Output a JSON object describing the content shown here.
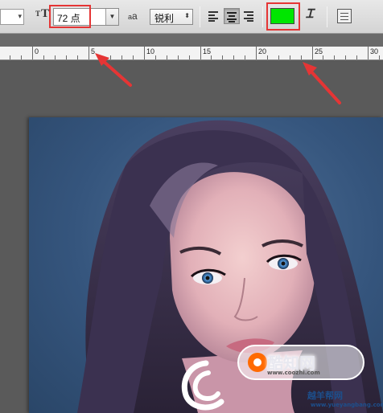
{
  "options_bar": {
    "font_size_value": "72 点",
    "antialias_value": "锐利",
    "text_color": "#00e600",
    "highlight_color": "#e53535"
  },
  "ruler": {
    "labels": [
      "0",
      "5",
      "10",
      "15",
      "20",
      "25",
      "30"
    ]
  },
  "canvas": {
    "image": "portrait-of-woman"
  },
  "watermarks": {
    "site_name": "酷知网",
    "url": "www.coozhi.com",
    "site_name_2": "越羊帮网",
    "url_2": "www.yueyangbang.com"
  }
}
